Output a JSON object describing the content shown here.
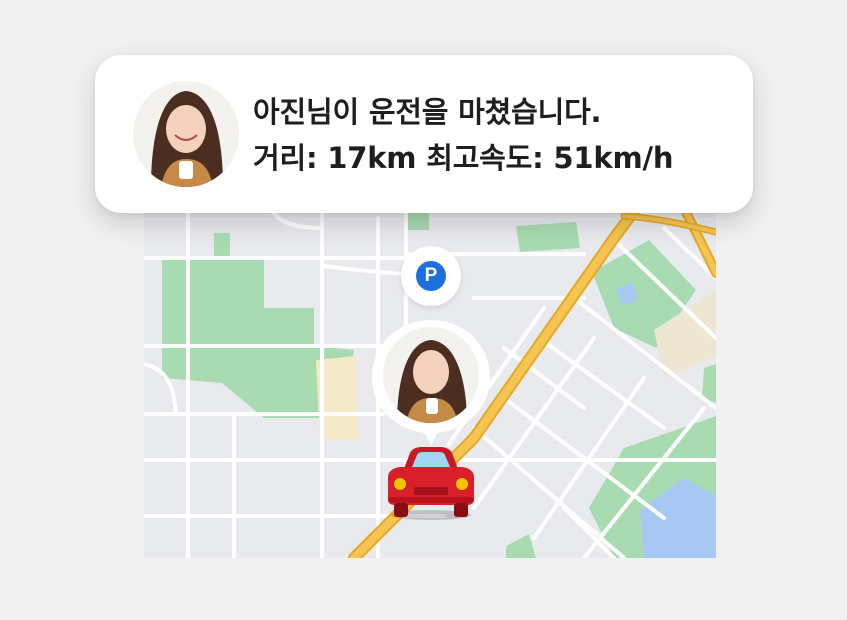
{
  "notification": {
    "line1": "아진님이 운전을 마쳤습니다.",
    "line2": "거리: 17km 최고속도: 51km/h"
  },
  "parking": {
    "label": "P"
  },
  "colors": {
    "background": "#f1f1f1",
    "map_base": "#e9eaee",
    "park_green": "#a9dbb2",
    "water_blue": "#a7c8f2",
    "highway_yellow": "#f6c451",
    "parking_blue": "#1d6fe0",
    "car_red": "#d81f2a"
  },
  "icons": {
    "avatar": "person-avatar-icon",
    "parking": "parking-icon",
    "car": "car-icon"
  }
}
